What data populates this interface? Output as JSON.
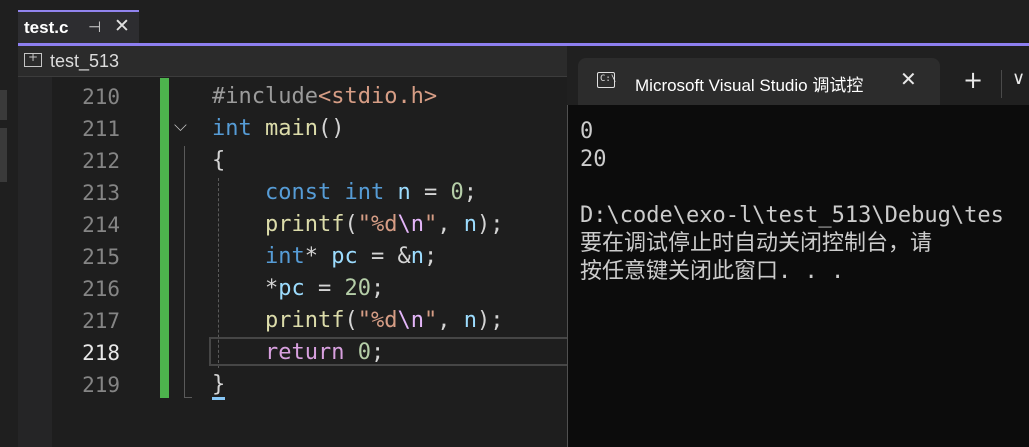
{
  "editor_tab": {
    "title": "test.c",
    "pin_glyph": "⊣",
    "close_glyph": "✕"
  },
  "nav_bar": {
    "project_label": "test_513"
  },
  "line_numbers": [
    "210",
    "211",
    "212",
    "213",
    "214",
    "215",
    "216",
    "217",
    "218",
    "219"
  ],
  "active_line": "218",
  "code": {
    "l210": {
      "include": "#include",
      "header": "<stdio.h>"
    },
    "l211": {
      "type": "int",
      "name": "main",
      "parens": "()"
    },
    "l212": {
      "brace": "{"
    },
    "l213": {
      "const": "const",
      "type": "int",
      "var": "n",
      "op": " = ",
      "num": "0",
      "end": ";"
    },
    "l214": {
      "fn": "printf",
      "open": "(",
      "fmt": "\"%d",
      "esc": "\\n",
      "q": "\"",
      "sep": ", ",
      "var": "n",
      "end": ");"
    },
    "l215": {
      "type": "int",
      "star": "*",
      "var": "pc",
      "op": " = &",
      "var2": "n",
      "end": ";"
    },
    "l216": {
      "star": "*",
      "var": "pc",
      "op": " = ",
      "num": "20",
      "end": ";"
    },
    "l217": {
      "fn": "printf",
      "open": "(",
      "fmt": "\"%d",
      "esc": "\\n",
      "q": "\"",
      "sep": ", ",
      "var": "n",
      "end": ");"
    },
    "l218": {
      "kw": "return",
      "num": "0",
      "end": ";"
    },
    "l219": {
      "brace": "}"
    }
  },
  "console": {
    "tab_title": "Microsoft Visual Studio 调试控",
    "new_tab_glyph": "+",
    "close_glyph": "✕",
    "dropdown_glyph": "∨",
    "output": [
      "0",
      "20",
      "",
      "D:\\code\\exo-l\\test_513\\Debug\\tes",
      "要在调试停止时自动关闭控制台，请",
      "按任意键关闭此窗口. . ."
    ]
  },
  "colors": {
    "accent": "#8d7ff0",
    "change_bar": "#4db34d",
    "keyword": "#569cd6",
    "function": "#dcdcaa"
  }
}
